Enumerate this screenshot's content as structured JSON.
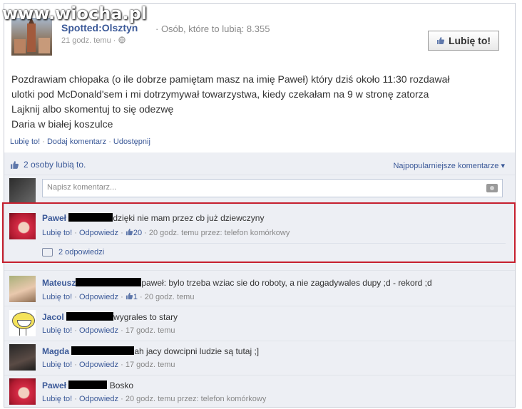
{
  "watermark": "www.wiocha.pl",
  "page": {
    "name": "Spotted:Olsztyn",
    "fans": "· Osób, które to lubią: 8.355",
    "time": "21 godz. temu ·",
    "like_button": "Lubię to!"
  },
  "post": {
    "lines": [
      "Pozdrawiam chłopaka (o ile dobrze pamiętam masz na imię Paweł) który dziś około 11:30 rozdawał",
      "ulotki pod McDonald'sem i mi dotrzymywał towarzystwa, kiedy czekałam na 9 w stronę zatorza",
      "Lajknij albo skomentuj to się odezwę",
      "Daria w białej koszulce"
    ]
  },
  "actions": {
    "like": "Lubię to!",
    "comment": "Dodaj komentarz",
    "share": "Udostępnij",
    "sep": " · "
  },
  "likes": {
    "text": "2 osoby lubią to.",
    "sort": "Najpopularniejsze komentarze ▾"
  },
  "composer": {
    "placeholder": "Napisz komentarz..."
  },
  "comments": [
    {
      "author": "Paweł",
      "text": "dzięki nie mam przez cb już dziewczyny",
      "like": "Lubię to!",
      "reply": "Odpowiedz",
      "likes_count": "20",
      "time": "· 20 godz. temu przez: telefon komórkowy",
      "replies": "2 odpowiedzi"
    },
    {
      "author": "Mateusz",
      "text": "paweł: bylo trzeba wziac sie do roboty, a nie zagadywales dupy ;d - rekord ;d",
      "like": "Lubię to!",
      "reply": "Odpowiedz",
      "likes_count": "1",
      "time": "· 20 godz. temu"
    },
    {
      "author": "Jacol",
      "text": "wygrales to stary",
      "like": "Lubię to!",
      "reply": "Odpowiedz",
      "time": "· 17 godz. temu"
    },
    {
      "author": "Magda",
      "text": "ah jacy dowcipni ludzie są tutaj ;]",
      "like": "Lubię to!",
      "reply": "Odpowiedz",
      "time": "· 17 godz. temu"
    },
    {
      "author": "Paweł",
      "text": "Bosko",
      "like": "Lubię to!",
      "reply": "Odpowiedz",
      "time": "· 20 godz. temu przez: telefon komórkowy"
    }
  ],
  "colors": {
    "link": "#3b5998",
    "highlight": "#c61f2e",
    "panel": "#edeff4"
  }
}
